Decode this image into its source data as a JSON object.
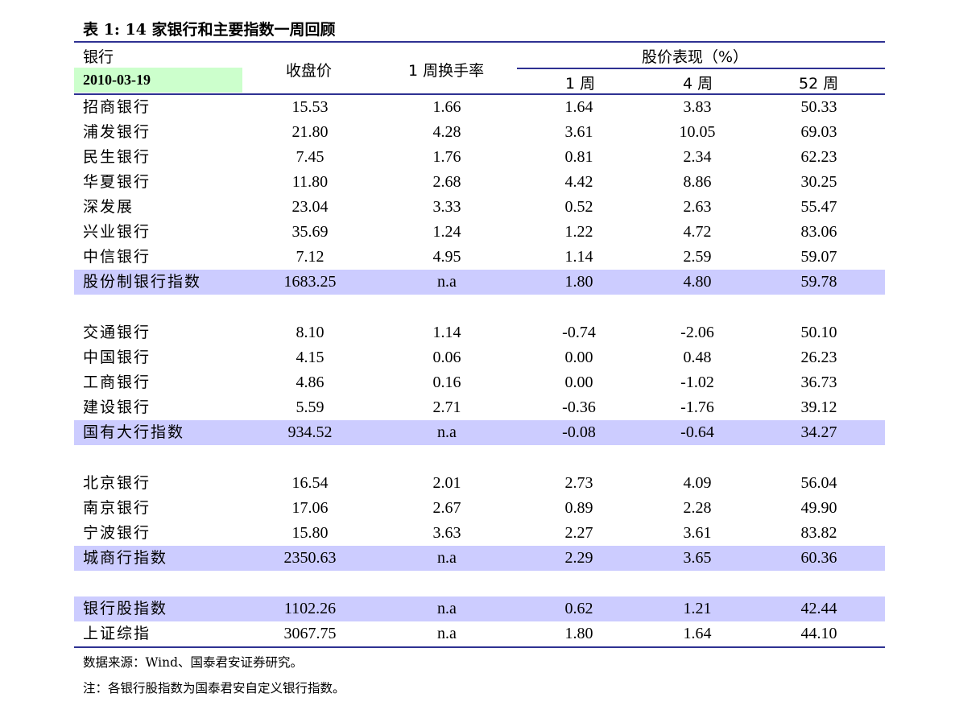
{
  "table": {
    "title": "表 1: 14 家银行和主要指数一周回顾",
    "header": {
      "bank_label": "银行",
      "date": "2010-03-19",
      "close_label": "收盘价",
      "turnover_label": "1 周换手率",
      "perf_group_label": "股价表现（%）",
      "perf_1w": "1 周",
      "perf_4w": "4 周",
      "perf_52w": "52 周"
    },
    "rows": [
      {
        "name": "招商银行",
        "close": "15.53",
        "turnover": "1.66",
        "w1": "1.64",
        "w4": "3.83",
        "w52": "50.33"
      },
      {
        "name": "浦发银行",
        "close": "21.80",
        "turnover": "4.28",
        "w1": "3.61",
        "w4": "10.05",
        "w52": "69.03"
      },
      {
        "name": "民生银行",
        "close": "7.45",
        "turnover": "1.76",
        "w1": "0.81",
        "w4": "2.34",
        "w52": "62.23"
      },
      {
        "name": "华夏银行",
        "close": "11.80",
        "turnover": "2.68",
        "w1": "4.42",
        "w4": "8.86",
        "w52": "30.25"
      },
      {
        "name": "深发展",
        "close": "23.04",
        "turnover": "3.33",
        "w1": "0.52",
        "w4": "2.63",
        "w52": "55.47"
      },
      {
        "name": "兴业银行",
        "close": "35.69",
        "turnover": "1.24",
        "w1": "1.22",
        "w4": "4.72",
        "w52": "83.06"
      },
      {
        "name": "中信银行",
        "close": "7.12",
        "turnover": "4.95",
        "w1": "1.14",
        "w4": "2.59",
        "w52": "59.07"
      },
      {
        "name": "股份制银行指数",
        "close": "1683.25",
        "turnover": "n.a",
        "w1": "1.80",
        "w4": "4.80",
        "w52": "59.78"
      },
      {
        "name": "交通银行",
        "close": "8.10",
        "turnover": "1.14",
        "w1": "-0.74",
        "w4": "-2.06",
        "w52": "50.10"
      },
      {
        "name": "中国银行",
        "close": "4.15",
        "turnover": "0.06",
        "w1": "0.00",
        "w4": "0.48",
        "w52": "26.23"
      },
      {
        "name": "工商银行",
        "close": "4.86",
        "turnover": "0.16",
        "w1": "0.00",
        "w4": "-1.02",
        "w52": "36.73"
      },
      {
        "name": "建设银行",
        "close": "5.59",
        "turnover": "2.71",
        "w1": "-0.36",
        "w4": "-1.76",
        "w52": "39.12"
      },
      {
        "name": "国有大行指数",
        "close": "934.52",
        "turnover": "n.a",
        "w1": "-0.08",
        "w4": "-0.64",
        "w52": "34.27"
      },
      {
        "name": "北京银行",
        "close": "16.54",
        "turnover": "2.01",
        "w1": "2.73",
        "w4": "4.09",
        "w52": "56.04"
      },
      {
        "name": "南京银行",
        "close": "17.06",
        "turnover": "2.67",
        "w1": "0.89",
        "w4": "2.28",
        "w52": "49.90"
      },
      {
        "name": "宁波银行",
        "close": "15.80",
        "turnover": "3.63",
        "w1": "2.27",
        "w4": "3.61",
        "w52": "83.82"
      },
      {
        "name": "城商行指数",
        "close": "2350.63",
        "turnover": "n.a",
        "w1": "2.29",
        "w4": "3.65",
        "w52": "60.36"
      },
      {
        "name": "银行股指数",
        "close": "1102.26",
        "turnover": "n.a",
        "w1": "0.62",
        "w4": "1.21",
        "w52": "42.44"
      },
      {
        "name": "上证综指",
        "close": "3067.75",
        "turnover": "n.a",
        "w1": "1.80",
        "w4": "1.64",
        "w52": "44.10"
      }
    ]
  },
  "notes": {
    "source": "数据来源：Wind、国泰君安证券研究。",
    "remark": "注：各银行股指数为国泰君安自定义银行指数。"
  },
  "colors": {
    "highlight_row": "#ccccff",
    "date_box": "#ccffcc",
    "rule": "#2e3192"
  }
}
